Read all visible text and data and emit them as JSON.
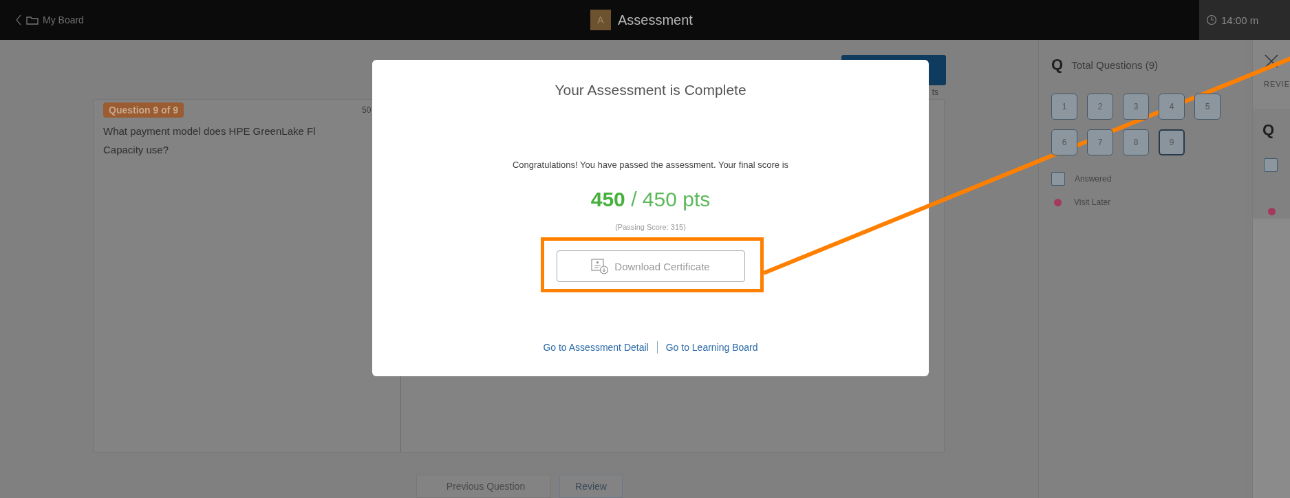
{
  "top_bar": {
    "back_label": "My Board",
    "app_badge": "A",
    "title": "Assessment",
    "timer": "14:00 m"
  },
  "question": {
    "badge": "Question 9 of 9",
    "points": "50",
    "points_tail": "ts",
    "text": "What payment model does HPE GreenLake Fl\nCapacity use?"
  },
  "nav_buttons": [
    {
      "label": "Previous Question",
      "kind": "prev",
      "disabled": true
    },
    {
      "label": "Review",
      "kind": "next",
      "disabled": false
    }
  ],
  "modal": {
    "title": "Your Assessment is Complete",
    "message": "Congratulations! You have passed the assessment. Your final score is",
    "score_earned": "450",
    "score_total": "/ 450 pts",
    "passing": "(Passing Score: 315)",
    "download_button": "Download Certificate",
    "links": [
      "Go to Assessment Detail",
      "Go to Learning Board"
    ]
  },
  "questions_panel": {
    "icon": "Q",
    "title": "Total Questions (9)",
    "numbers": [
      {
        "label": "1",
        "selected": false
      },
      {
        "label": "2",
        "selected": false
      },
      {
        "label": "3",
        "selected": false
      },
      {
        "label": "4",
        "selected": false
      },
      {
        "label": "5",
        "selected": false
      },
      {
        "label": "6",
        "selected": false
      },
      {
        "label": "7",
        "selected": false
      },
      {
        "label": "8",
        "selected": false
      },
      {
        "label": "9",
        "selected": true
      }
    ],
    "legend": [
      {
        "label": "Answered",
        "kind": "box"
      },
      {
        "label": "Visit Later",
        "kind": "dot",
        "color": "#a33a5c"
      }
    ]
  },
  "review_panel": {
    "tab": "REVIE",
    "icon": "Q",
    "dot": {
      "color": "#a33a5c"
    }
  }
}
